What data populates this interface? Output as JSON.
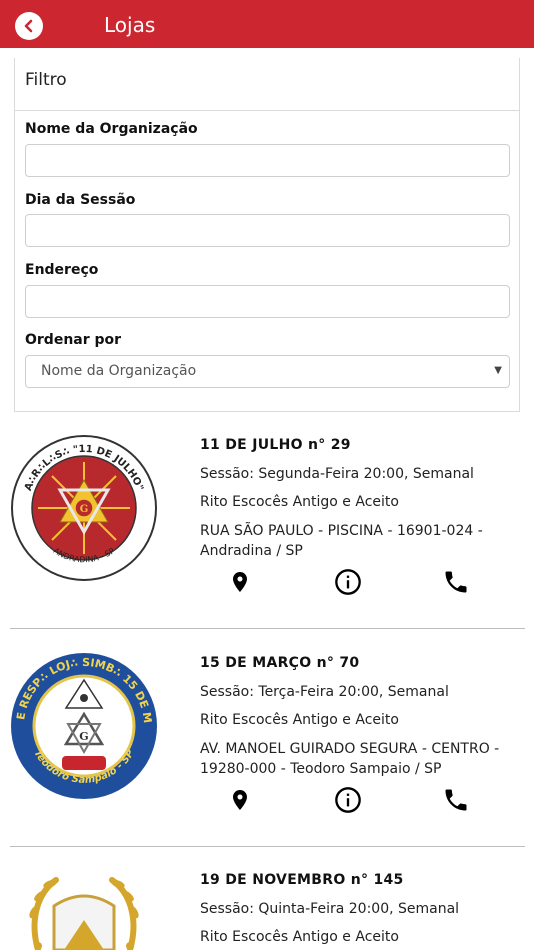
{
  "appbar": {
    "title": "Lojas"
  },
  "filter": {
    "title": "Filtro",
    "fields": [
      {
        "label": "Nome da Organização",
        "value": ""
      },
      {
        "label": "Dia da Sessão",
        "value": ""
      },
      {
        "label": "Endereço",
        "value": ""
      }
    ],
    "order": {
      "label": "Ordenar por",
      "selected": "Nome da Organização"
    }
  },
  "lodges": [
    {
      "name": "11 DE JULHO n° 29",
      "session": "Sessão: Segunda-Feira 20:00, Semanal",
      "rite": "Rito Escocês Antigo e Aceito",
      "address": "RUA SÃO PAULO - PISCINA - 16901-024 - Andradina / SP",
      "logo": {
        "ring_text": "A∴R∴L∴S∴ \"11 DE JULHO\"",
        "city": "ANDRADINA - SP"
      }
    },
    {
      "name": "15 DE MARÇO n° 70",
      "session": "Sessão: Terça-Feira 20:00, Semanal",
      "rite": "Rito Escocês Antigo e Aceito",
      "address": "AV. MANOEL GUIRADO SEGURA - CENTRO - 19280-000 - Teodoro Sampaio / SP",
      "logo": {
        "ring_text": "AUG∴ E RESP∴ LOJ∴ SIMB∴ 15 DE MARÇO",
        "city": "Teodoro Sampaio - SP"
      }
    },
    {
      "name": "19 DE NOVEMBRO n° 145",
      "session": "Sessão: Quinta-Feira 20:00, Semanal",
      "rite": "Rito Escocês Antigo e Aceito",
      "address": "",
      "logo": {
        "ring_text": "",
        "city": ""
      }
    }
  ],
  "icons": {
    "back": "chevron-left-icon",
    "map": "map-pin-icon",
    "info": "info-icon",
    "phone": "phone-icon"
  },
  "colors": {
    "appbar": "#cc2630",
    "logo1_red": "#b8292e",
    "logo2_blue": "#1f4f9c",
    "logo3_gold": "#d4a72c"
  }
}
